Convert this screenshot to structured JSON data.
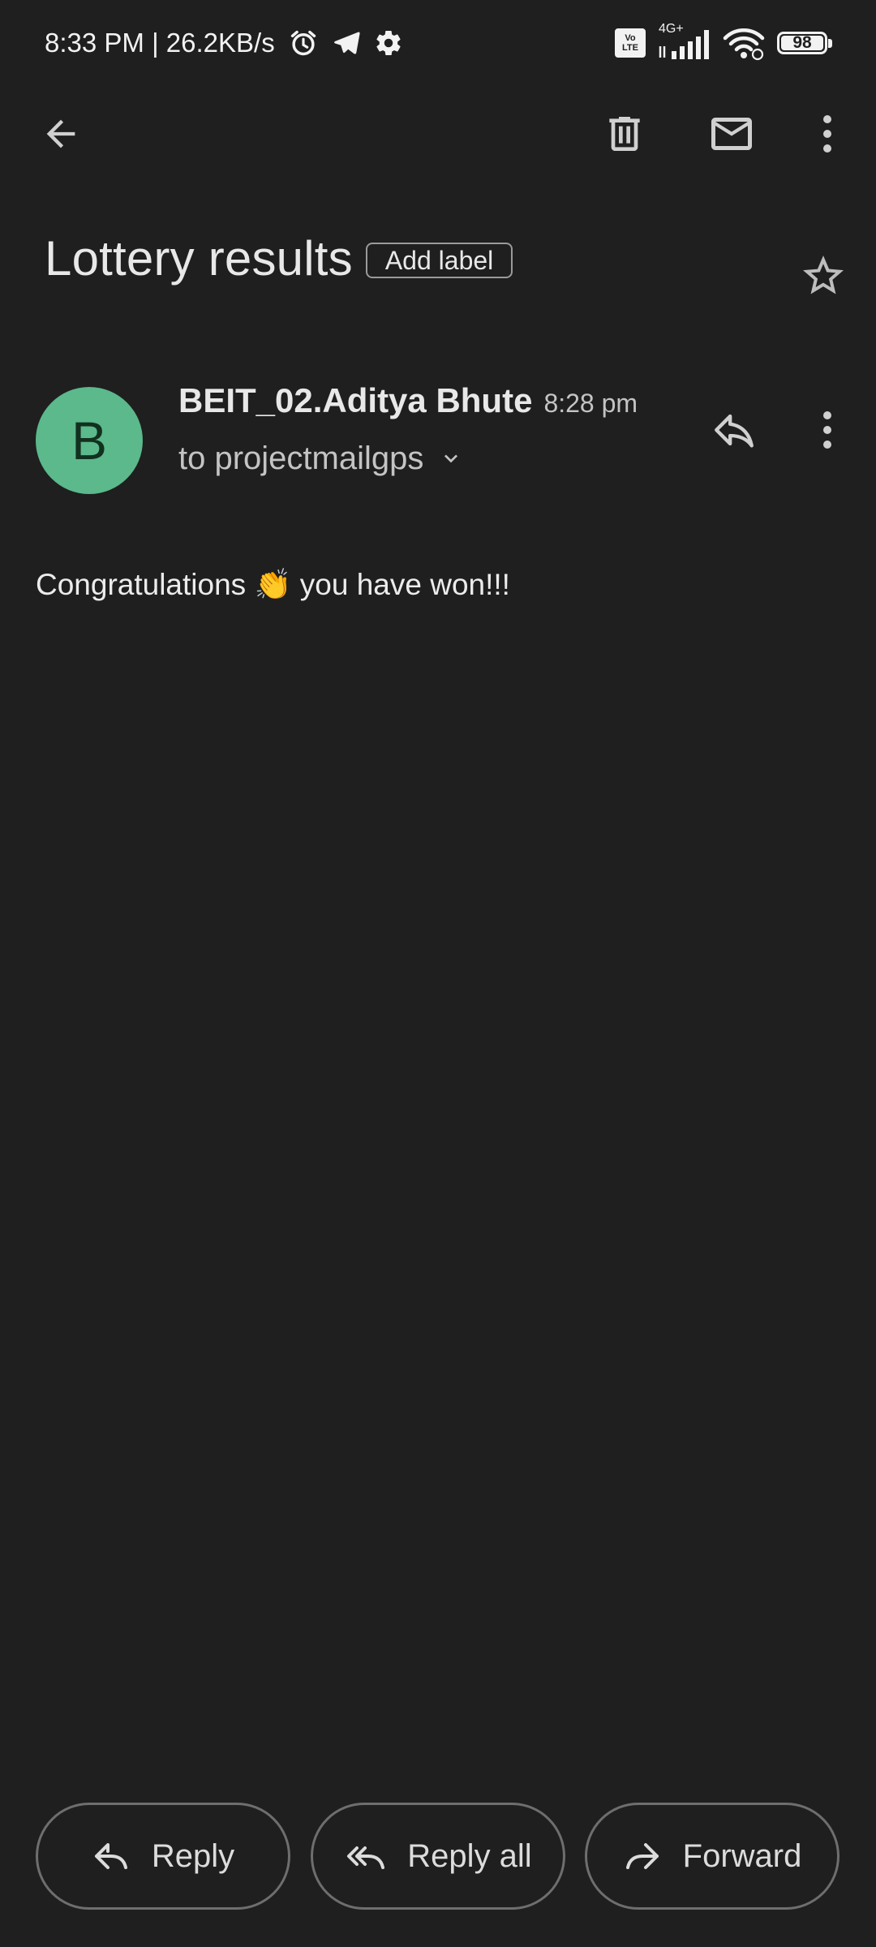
{
  "status_bar": {
    "time_speed": "8:33 PM | 26.2KB/s",
    "network": "4G+",
    "battery": "98",
    "icons": [
      "alarm-icon",
      "telegram-icon",
      "settings-icon",
      "volte-icon",
      "signal-icon",
      "wifi-icon",
      "battery-icon"
    ]
  },
  "toolbar": {
    "icons": [
      "back-arrow-icon",
      "delete-icon",
      "mark-unread-icon",
      "more-vert-icon"
    ]
  },
  "email": {
    "subject": "Lottery results",
    "add_label": "Add label",
    "sender_initial": "B",
    "sender_name": "BEIT_02.Aditya Bhute",
    "time": "8:28 pm",
    "recipient": "to projectmailgps",
    "body": "Congratulations 👏 you have won!!!",
    "avatar_color": "#5bb98b"
  },
  "actions": {
    "reply": "Reply",
    "reply_all": "Reply all",
    "forward": "Forward"
  },
  "colors": {
    "background": "#1f1f1f",
    "text": "#e3e3e3"
  }
}
